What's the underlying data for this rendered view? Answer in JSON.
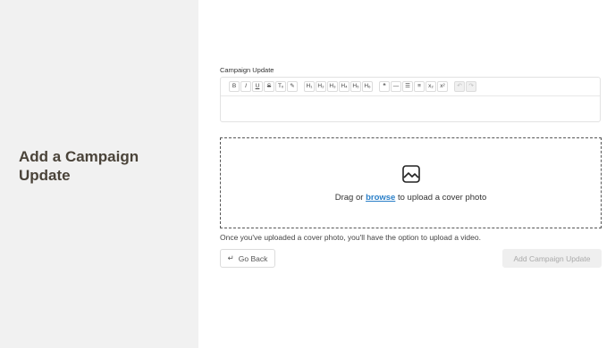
{
  "page": {
    "title": "Add a Campaign Update"
  },
  "editor": {
    "label": "Campaign Update",
    "toolbar": [
      {
        "name": "bold-button",
        "glyph": "B",
        "enabled": true
      },
      {
        "name": "italic-button",
        "glyph": "I",
        "enabled": true
      },
      {
        "name": "underline-button",
        "glyph": "U",
        "enabled": true
      },
      {
        "name": "strike-button",
        "glyph": "S",
        "enabled": true
      },
      {
        "name": "clear-format-button",
        "glyph": "Tₓ",
        "enabled": true
      },
      {
        "name": "highlight-button",
        "glyph": "✎",
        "enabled": true
      },
      {
        "name": "h1-button",
        "glyph": "H₁",
        "enabled": true
      },
      {
        "name": "h2-button",
        "glyph": "H₂",
        "enabled": true
      },
      {
        "name": "h3-button",
        "glyph": "H₃",
        "enabled": true
      },
      {
        "name": "h4-button",
        "glyph": "H₄",
        "enabled": true
      },
      {
        "name": "h5-button",
        "glyph": "H₅",
        "enabled": true
      },
      {
        "name": "h6-button",
        "glyph": "H₆",
        "enabled": true
      },
      {
        "name": "quote-button",
        "glyph": "❝",
        "enabled": true
      },
      {
        "name": "horizontal-rule-button",
        "glyph": "—",
        "enabled": true
      },
      {
        "name": "bullet-list-button",
        "glyph": "☰",
        "enabled": true
      },
      {
        "name": "ordered-list-button",
        "glyph": "≡",
        "enabled": true
      },
      {
        "name": "subscript-button",
        "glyph": "x₂",
        "enabled": true
      },
      {
        "name": "superscript-button",
        "glyph": "x²",
        "enabled": true
      },
      {
        "name": "undo-button",
        "glyph": "↶",
        "enabled": false
      },
      {
        "name": "redo-button",
        "glyph": "↷",
        "enabled": false
      }
    ]
  },
  "upload": {
    "icon": "image-icon",
    "text_before": "Drag or ",
    "link_text": "browse",
    "text_after": " to upload a cover photo",
    "hint": "Once you've uploaded a cover photo, you'll have the option to upload a video."
  },
  "actions": {
    "back_icon": "↵",
    "back_label": "Go Back",
    "submit_label": "Add Campaign Update"
  },
  "colors": {
    "link": "#2a7fc8",
    "title": "#4a4339",
    "sidebar_bg": "#f1f1f1"
  }
}
